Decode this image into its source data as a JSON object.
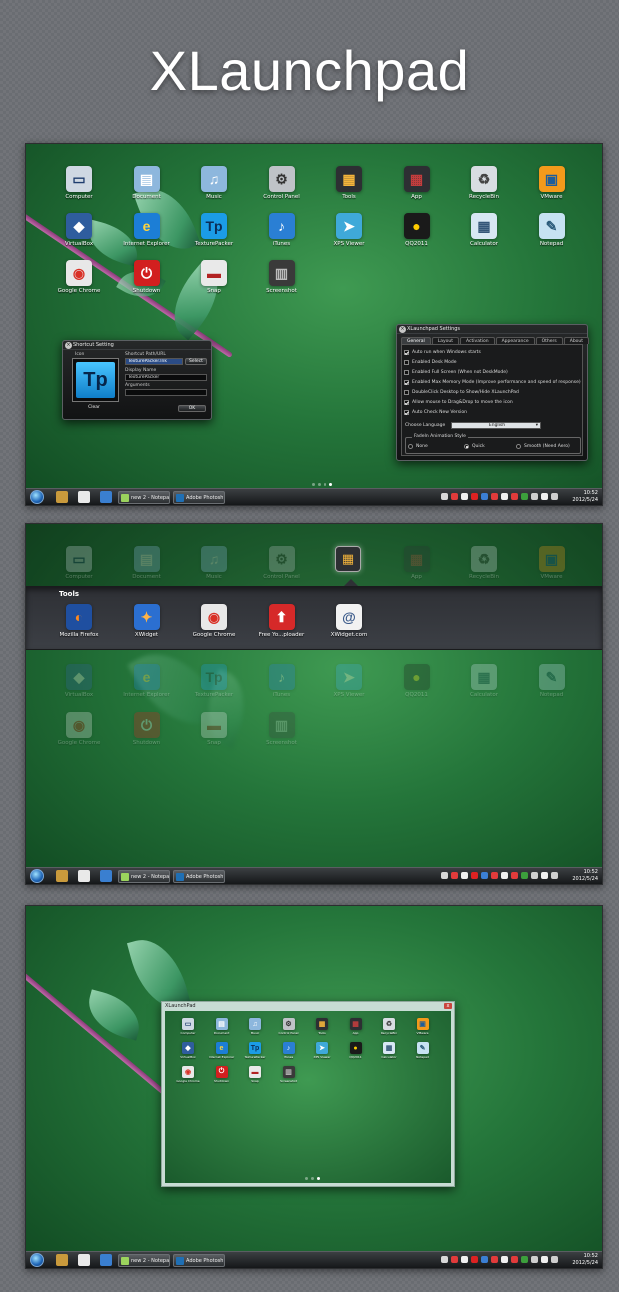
{
  "title": "XLaunchpad",
  "desktop_icons": [
    {
      "label": "Computer",
      "icon": "computer-icon",
      "glyph": "▭",
      "bg": "#cfd8e3",
      "fg": "#1e3c6e"
    },
    {
      "label": "Document",
      "icon": "folder-icon",
      "glyph": "▤",
      "bg": "#8db7dd",
      "fg": "#ffffff"
    },
    {
      "label": "Music",
      "icon": "music-folder-icon",
      "glyph": "♫",
      "bg": "#8db7dd",
      "fg": "#ffffff"
    },
    {
      "label": "Control Panel",
      "icon": "control-panel-icon",
      "glyph": "⚙",
      "bg": "#bfc3c8",
      "fg": "#333333"
    },
    {
      "label": "Tools",
      "icon": "tools-folder-icon",
      "glyph": "▦",
      "bg": "#2d2f33",
      "fg": "#f5b53b"
    },
    {
      "label": "App",
      "icon": "app-folder-icon",
      "glyph": "▦",
      "bg": "#2d2f33",
      "fg": "#c33d3d"
    },
    {
      "label": "RecycleBin",
      "icon": "recycle-bin-icon",
      "glyph": "♻",
      "bg": "#d8dde2",
      "fg": "#444444"
    },
    {
      "label": "VMware",
      "icon": "vmware-icon",
      "glyph": "▣",
      "bg": "#f39a1b",
      "fg": "#1e5d9a"
    },
    {
      "label": "VirtualBox",
      "icon": "virtualbox-icon",
      "glyph": "◆",
      "bg": "#2f5d9e",
      "fg": "#ffffff"
    },
    {
      "label": "Internet Explorer",
      "icon": "internet-explorer-icon",
      "glyph": "e",
      "bg": "#1c7ed6",
      "fg": "#ffd43b"
    },
    {
      "label": "TexturePacker",
      "icon": "texturepacker-icon",
      "glyph": "Tp",
      "bg": "#1b9ce6",
      "fg": "#0b2d57"
    },
    {
      "label": "iTunes",
      "icon": "itunes-icon",
      "glyph": "♪",
      "bg": "#2a7fd4",
      "fg": "#ffffff"
    },
    {
      "label": "XPS Viewer",
      "icon": "xps-viewer-icon",
      "glyph": "➤",
      "bg": "#3fa9d9",
      "fg": "#ffffff"
    },
    {
      "label": "QQ2011",
      "icon": "qq-icon",
      "glyph": "●",
      "bg": "#1a1a1a",
      "fg": "#ffcc00"
    },
    {
      "label": "Calculator",
      "icon": "calculator-icon",
      "glyph": "▦",
      "bg": "#d7e7f3",
      "fg": "#335577"
    },
    {
      "label": "Notepad",
      "icon": "notepad-icon",
      "glyph": "✎",
      "bg": "#c6e2f2",
      "fg": "#2b5b7a"
    },
    {
      "label": "Google Chrome",
      "icon": "chrome-icon",
      "glyph": "◉",
      "bg": "#e8e8e8",
      "fg": "#d93025"
    },
    {
      "label": "Shutdown",
      "icon": "shutdown-icon",
      "glyph": "⏻",
      "bg": "#d21f1f",
      "fg": "#ffffff"
    },
    {
      "label": "Snap",
      "icon": "snap-icon",
      "glyph": "▬",
      "bg": "#e9e9e9",
      "fg": "#b22222"
    },
    {
      "label": "Screenshot",
      "icon": "screenshot-icon",
      "glyph": "▥",
      "bg": "#3a3a3a",
      "fg": "#bbbbbb"
    }
  ],
  "shortcut_dialog": {
    "title": "Shortcut Setting",
    "icon_label": "Icon",
    "icon_glyph": "Tp",
    "clear_label": "Clear",
    "path_label": "Shortcut Path/URL",
    "path_value": "TexturePacker.lnk",
    "select_label": "Select",
    "display_label": "Display Name",
    "display_value": "TexturePacker",
    "args_label": "Arguments",
    "args_value": "",
    "ok_label": "OK"
  },
  "settings_dialog": {
    "title": "XLaunchpad Settings",
    "tabs": [
      "General",
      "Layout",
      "Activation",
      "Appearance",
      "Others",
      "About"
    ],
    "active_tab": "General",
    "options": [
      {
        "label": "Auto run when Windows starts",
        "checked": true
      },
      {
        "label": "Enabled Desk Mode",
        "checked": false
      },
      {
        "label": "Enabled Full Screen (When not DeskMode)",
        "checked": false
      },
      {
        "label": "Enabled Max Memory Mode (Improve performance and speed of response)",
        "checked": true
      },
      {
        "label": "DoubleClick Desktop to Show/Hide XLaunchPad",
        "checked": false
      },
      {
        "label": "Allow mouse to Drag&Drop to move the icon",
        "checked": true
      },
      {
        "label": "Auto Check New Version",
        "checked": true
      }
    ],
    "language_label": "Choose Language",
    "language_value": "English",
    "fade_group_label": "FadeIn Animation Style",
    "fade_options": [
      {
        "label": "None",
        "selected": false
      },
      {
        "label": "Quick",
        "selected": true
      },
      {
        "label": "Smooth (Need Aero)",
        "selected": false
      }
    ]
  },
  "taskbar": {
    "tasks": [
      {
        "label": "new 2 - Notepa...",
        "color": "#9bd35d"
      },
      {
        "label": "Adobe Photosh...",
        "color": "#1f6fb4"
      }
    ],
    "pinned_colors": [
      "#c99a3c",
      "#e9e9e9",
      "#3a7fd0"
    ],
    "tray_colors": [
      "#d8d8d8",
      "#e23b3b",
      "#f0f0f0",
      "#d22",
      "#3b7fd4",
      "#e23b3b",
      "#f0f0f0",
      "#e23b3b",
      "#3c9f3c",
      "#cfcfcf",
      "#f0f0f0",
      "#cfcfcf"
    ],
    "clock_time": "10:52",
    "clock_date": "2012/5/24"
  },
  "tools_folder": {
    "title": "Tools",
    "items": [
      {
        "label": "Mozilla Firefox",
        "icon": "firefox-icon",
        "glyph": "◐",
        "bg": "#1f4fa0",
        "fg": "#ff8a1e"
      },
      {
        "label": "XWidget",
        "icon": "xwidget-icon",
        "glyph": "✦",
        "bg": "#2b6fd1",
        "fg": "#ffb347"
      },
      {
        "label": "Google Chrome",
        "icon": "chrome-icon",
        "glyph": "◉",
        "bg": "#e8e8e8",
        "fg": "#d93025"
      },
      {
        "label": "Free Yo...ploader",
        "icon": "uploader-icon",
        "glyph": "⬆",
        "bg": "#d62929",
        "fg": "#ffffff"
      },
      {
        "label": "XWidget.com",
        "icon": "http-link-icon",
        "glyph": "@",
        "bg": "#f2f2f2",
        "fg": "#3a5a8a"
      }
    ]
  },
  "window": {
    "title": "XLaunchPad",
    "close_glyph": "x"
  }
}
